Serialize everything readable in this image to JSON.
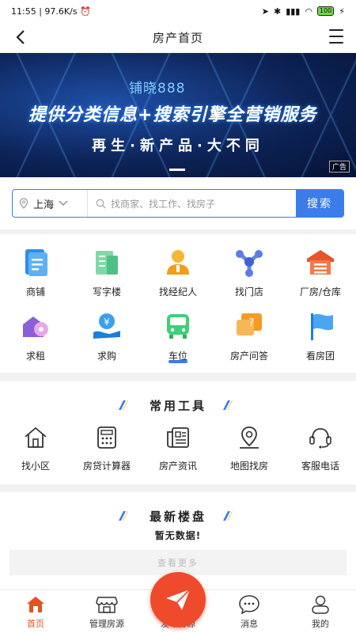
{
  "status": {
    "time": "11:55",
    "speed": "97.6K/s",
    "battery": "100"
  },
  "nav": {
    "title": "房产首页"
  },
  "banner": {
    "brand": "铺晓888",
    "headline": "提供分类信息+搜索引擎全营销服务",
    "subline": "再生·新产品·大不同",
    "ad_label": "广告"
  },
  "search": {
    "city": "上海",
    "placeholder": "找商家、找工作、找房子",
    "button": "搜索"
  },
  "categories": [
    {
      "label": "商铺",
      "icon": "shop-doc-icon"
    },
    {
      "label": "写字楼",
      "icon": "office-building-icon"
    },
    {
      "label": "找经纪人",
      "icon": "agent-icon"
    },
    {
      "label": "找门店",
      "icon": "store-network-icon"
    },
    {
      "label": "厂房/仓库",
      "icon": "warehouse-icon"
    },
    {
      "label": "求租",
      "icon": "rent-key-icon"
    },
    {
      "label": "求购",
      "icon": "buy-yen-icon"
    },
    {
      "label": "车位",
      "icon": "parking-bus-icon"
    },
    {
      "label": "房产问答",
      "icon": "qa-bubble-icon"
    },
    {
      "label": "看房团",
      "icon": "flag-icon"
    }
  ],
  "tools": {
    "title": "常用工具",
    "items": [
      {
        "label": "找小区",
        "icon": "house-icon"
      },
      {
        "label": "房贷计算器",
        "icon": "calculator-icon"
      },
      {
        "label": "房产资讯",
        "icon": "news-icon"
      },
      {
        "label": "地图找房",
        "icon": "map-pin-icon"
      },
      {
        "label": "客服电话",
        "icon": "headset-icon"
      }
    ]
  },
  "latest": {
    "title": "最新楼盘",
    "empty": "暂无数据!",
    "more": "查看更多"
  },
  "tabbar": [
    {
      "label": "首页",
      "icon": "home-icon",
      "active": true
    },
    {
      "label": "管理房源",
      "icon": "storefront-icon",
      "active": false
    },
    {
      "label": "发布房源",
      "icon": "paper-plane-icon",
      "active": false
    },
    {
      "label": "消息",
      "icon": "chat-icon",
      "active": false
    },
    {
      "label": "我的",
      "icon": "user-icon",
      "active": false
    }
  ],
  "colors": {
    "accent": "#3b7de9",
    "active_tab": "#e8501e",
    "publish": "#ef4a2c"
  }
}
